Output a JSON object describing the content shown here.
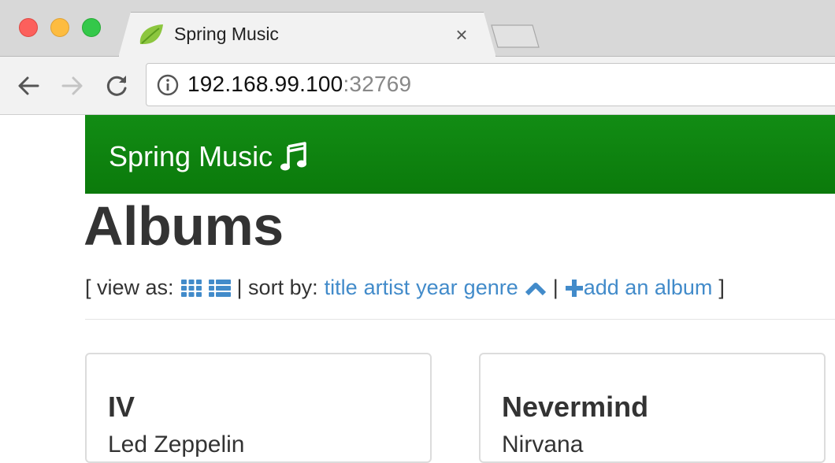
{
  "browser": {
    "tab_title": "Spring Music",
    "close_glyph": "×",
    "url_host": "192.168.99.100",
    "url_port": ":32769",
    "colors": {
      "close": "#fc605c",
      "minimize": "#fdbc40",
      "zoom": "#34c84a"
    }
  },
  "app": {
    "brand": "Spring Music",
    "brand_icon": "music-note-icon",
    "accent_color": "#128c14",
    "link_color": "#428bca"
  },
  "page": {
    "title": "Albums",
    "controls": {
      "open_bracket": "[ view as:",
      "sort_prefix": "| sort by:",
      "sort_title": "title",
      "sort_artist": "artist",
      "sort_year": "year",
      "sort_genre": "genre",
      "separator": "|",
      "add_album": "add an album",
      "close_bracket": "]",
      "icons": [
        "grid-view-icon",
        "list-view-icon",
        "sort-ascending-icon",
        "plus-icon"
      ]
    }
  },
  "albums": [
    {
      "title": "IV",
      "artist": "Led Zeppelin"
    },
    {
      "title": "Nevermind",
      "artist": "Nirvana"
    }
  ]
}
